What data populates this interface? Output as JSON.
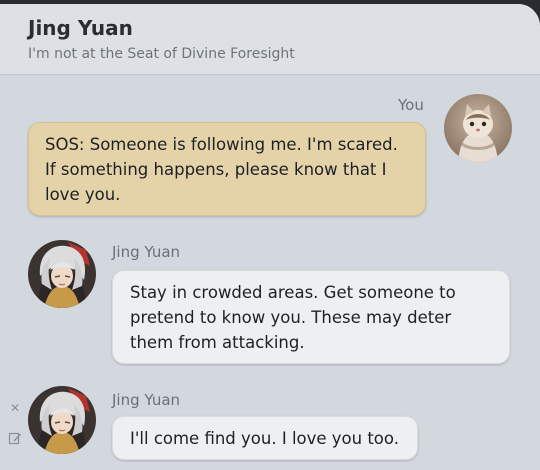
{
  "header": {
    "title": "Jing Yuan",
    "subtitle": "I'm not at the Seat of Divine Foresight"
  },
  "messages": [
    {
      "sender": "You",
      "text": "SOS: Someone is following me. I'm scared. If something happens, please know that I love you."
    },
    {
      "sender": "Jing Yuan",
      "text": "Stay in crowded areas. Get someone to pretend to know you. These may deter them from attacking."
    },
    {
      "sender": "Jing Yuan",
      "text": "I'll come find you. I love you too."
    }
  ],
  "icons": {
    "close": "close-icon",
    "edit": "edit-icon",
    "user_avatar": "cat-avatar",
    "contact_avatar": "jing-yuan-avatar"
  },
  "colors": {
    "panel": "#d3d8de",
    "my_bubble": "#e4d3a9",
    "their_bubble": "#eeeff1"
  }
}
